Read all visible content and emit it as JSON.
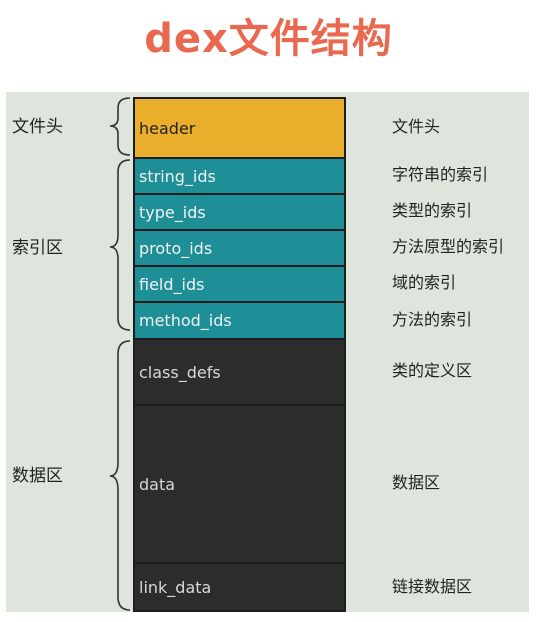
{
  "title": "dex文件结构",
  "groups": [
    {
      "label": "文件头"
    },
    {
      "label": "索引区"
    },
    {
      "label": "数据区"
    }
  ],
  "sections": [
    {
      "name": "header",
      "desc": "文件头"
    },
    {
      "name": "string_ids",
      "desc": "字符串的索引"
    },
    {
      "name": "type_ids",
      "desc": "类型的索引"
    },
    {
      "name": "proto_ids",
      "desc": "方法原型的索引"
    },
    {
      "name": "field_ids",
      "desc": "域的索引"
    },
    {
      "name": "method_ids",
      "desc": "方法的索引"
    },
    {
      "name": "class_defs",
      "desc": "类的定义区"
    },
    {
      "name": "data",
      "desc": "数据区"
    },
    {
      "name": "link_data",
      "desc": "链接数据区"
    }
  ],
  "colors": {
    "title": "#e8694f",
    "header_block": "#e9af2c",
    "index_block": "#1e8e97",
    "data_block": "#2c2c2c",
    "panel_bg": "#dde5dc"
  }
}
